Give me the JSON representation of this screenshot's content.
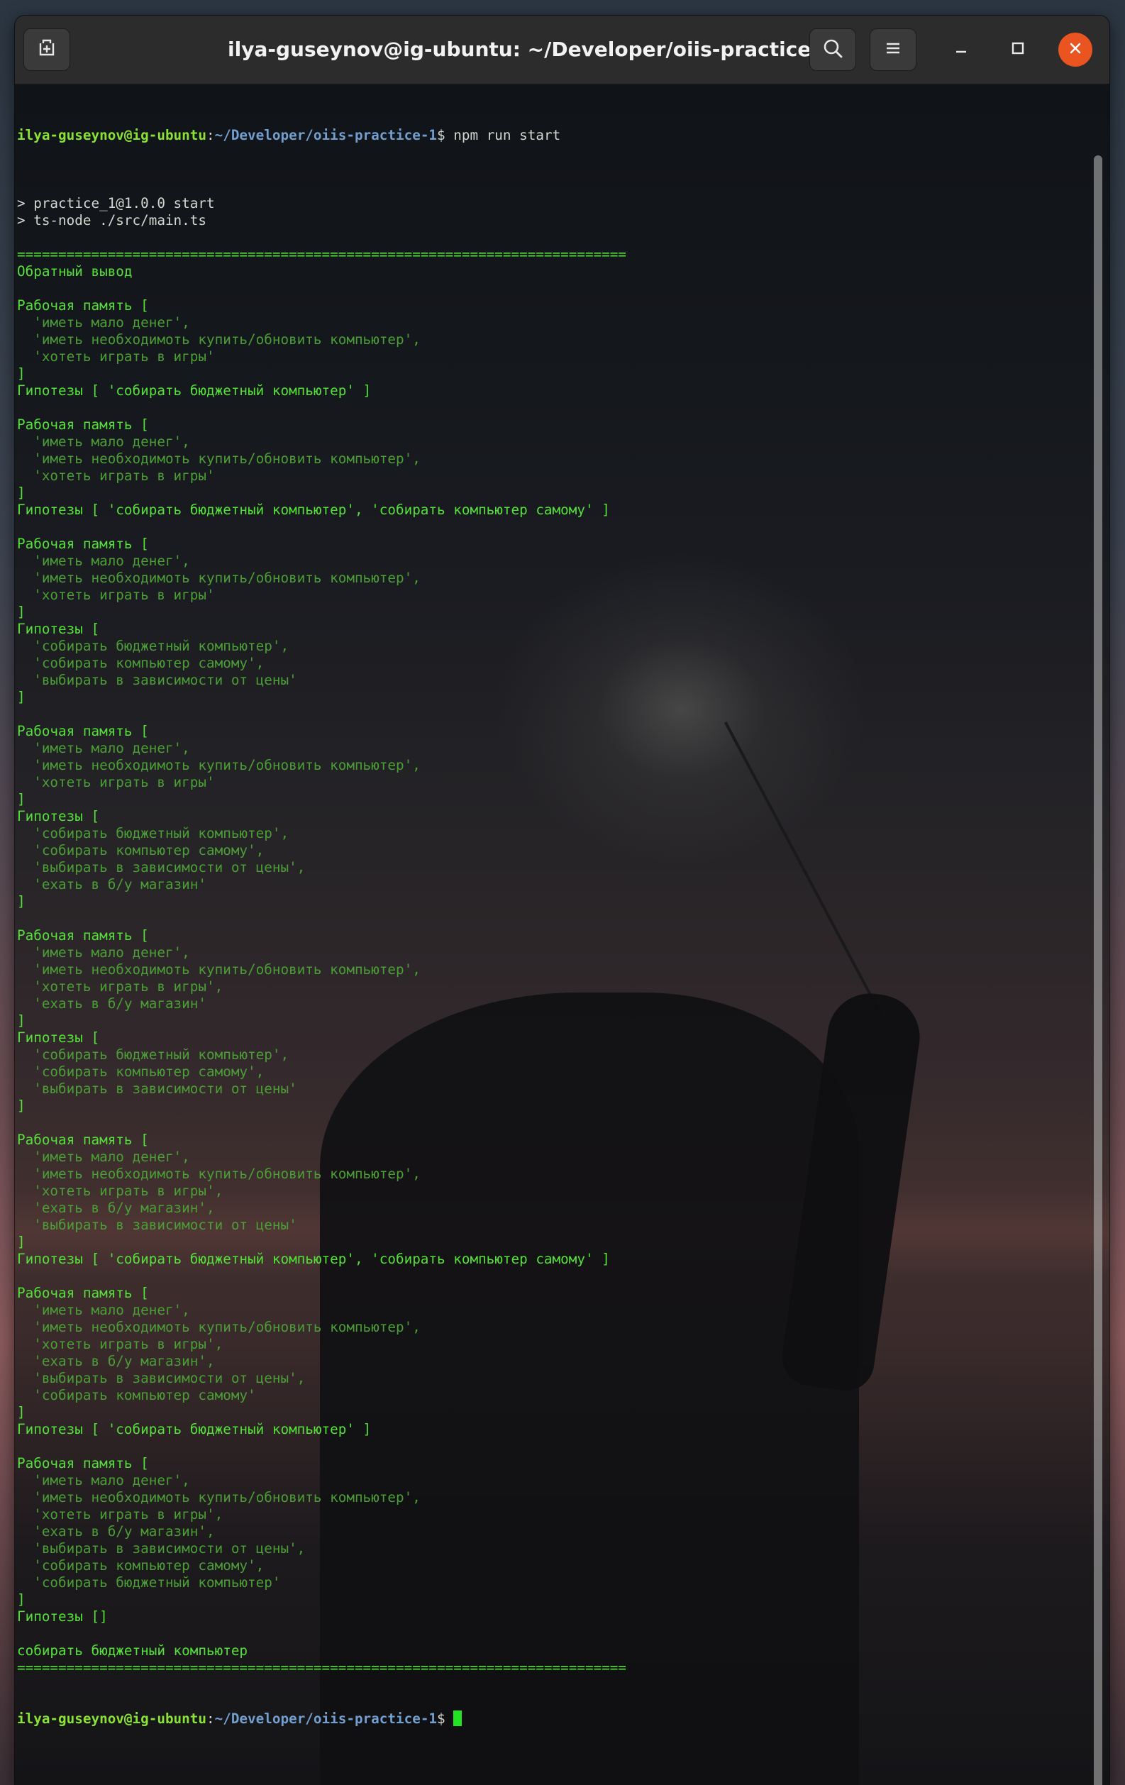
{
  "window": {
    "title": "ilya-guseynov@ig-ubuntu: ~/Developer/oiis-practice-1"
  },
  "titlebar": {
    "new_tab_icon": "new-tab-icon",
    "search_icon": "search-icon",
    "menu_icon": "hamburger-menu-icon",
    "minimize_icon": "minimize-icon",
    "maximize_icon": "maximize-icon",
    "close_icon": "close-icon",
    "close_color": "#e95420"
  },
  "prompt": {
    "user_host": "ilya-guseynov@ig-ubuntu",
    "separator": ":",
    "path": "~/Developer/oiis-practice-1",
    "dollar": "$ ",
    "command": "npm run start"
  },
  "colors": {
    "prompt_user": "#8ae234",
    "prompt_path": "#729fcf",
    "output_green": "#4ea83a",
    "cursor": "#22e422"
  },
  "output": [
    "",
    "> practice_1@1.0.0 start",
    "> ts-node ./src/main.ts",
    "",
    "==========================================================================",
    "Обратный вывод",
    "",
    "Рабочая память [",
    "  'иметь мало денег',",
    "  'иметь необходимоть купить/обновить компьютер',",
    "  'хотеть играть в игры'",
    "]",
    "Гипотезы [ 'собирать бюджетный компьютер' ]",
    "",
    "Рабочая память [",
    "  'иметь мало денег',",
    "  'иметь необходимоть купить/обновить компьютер',",
    "  'хотеть играть в игры'",
    "]",
    "Гипотезы [ 'собирать бюджетный компьютер', 'собирать компьютер самому' ]",
    "",
    "Рабочая память [",
    "  'иметь мало денег',",
    "  'иметь необходимоть купить/обновить компьютер',",
    "  'хотеть играть в игры'",
    "]",
    "Гипотезы [",
    "  'собирать бюджетный компьютер',",
    "  'собирать компьютер самому',",
    "  'выбирать в зависимости от цены'",
    "]",
    "",
    "Рабочая память [",
    "  'иметь мало денег',",
    "  'иметь необходимоть купить/обновить компьютер',",
    "  'хотеть играть в игры'",
    "]",
    "Гипотезы [",
    "  'собирать бюджетный компьютер',",
    "  'собирать компьютер самому',",
    "  'выбирать в зависимости от цены',",
    "  'ехать в б/у магазин'",
    "]",
    "",
    "Рабочая память [",
    "  'иметь мало денег',",
    "  'иметь необходимоть купить/обновить компьютер',",
    "  'хотеть играть в игры',",
    "  'ехать в б/у магазин'",
    "]",
    "Гипотезы [",
    "  'собирать бюджетный компьютер',",
    "  'собирать компьютер самому',",
    "  'выбирать в зависимости от цены'",
    "]",
    "",
    "Рабочая память [",
    "  'иметь мало денег',",
    "  'иметь необходимоть купить/обновить компьютер',",
    "  'хотеть играть в игры',",
    "  'ехать в б/у магазин',",
    "  'выбирать в зависимости от цены'",
    "]",
    "Гипотезы [ 'собирать бюджетный компьютер', 'собирать компьютер самому' ]",
    "",
    "Рабочая память [",
    "  'иметь мало денег',",
    "  'иметь необходимоть купить/обновить компьютер',",
    "  'хотеть играть в игры',",
    "  'ехать в б/у магазин',",
    "  'выбирать в зависимости от цены',",
    "  'собирать компьютер самому'",
    "]",
    "Гипотезы [ 'собирать бюджетный компьютер' ]",
    "",
    "Рабочая память [",
    "  'иметь мало денег',",
    "  'иметь необходимоть купить/обновить компьютер',",
    "  'хотеть играть в игры',",
    "  'ехать в б/у магазин',",
    "  'выбирать в зависимости от цены',",
    "  'собирать компьютер самому',",
    "  'собирать бюджетный компьютер'",
    "]",
    "Гипотезы []",
    "",
    "собирать бюджетный компьютер",
    "=========================================================================="
  ]
}
